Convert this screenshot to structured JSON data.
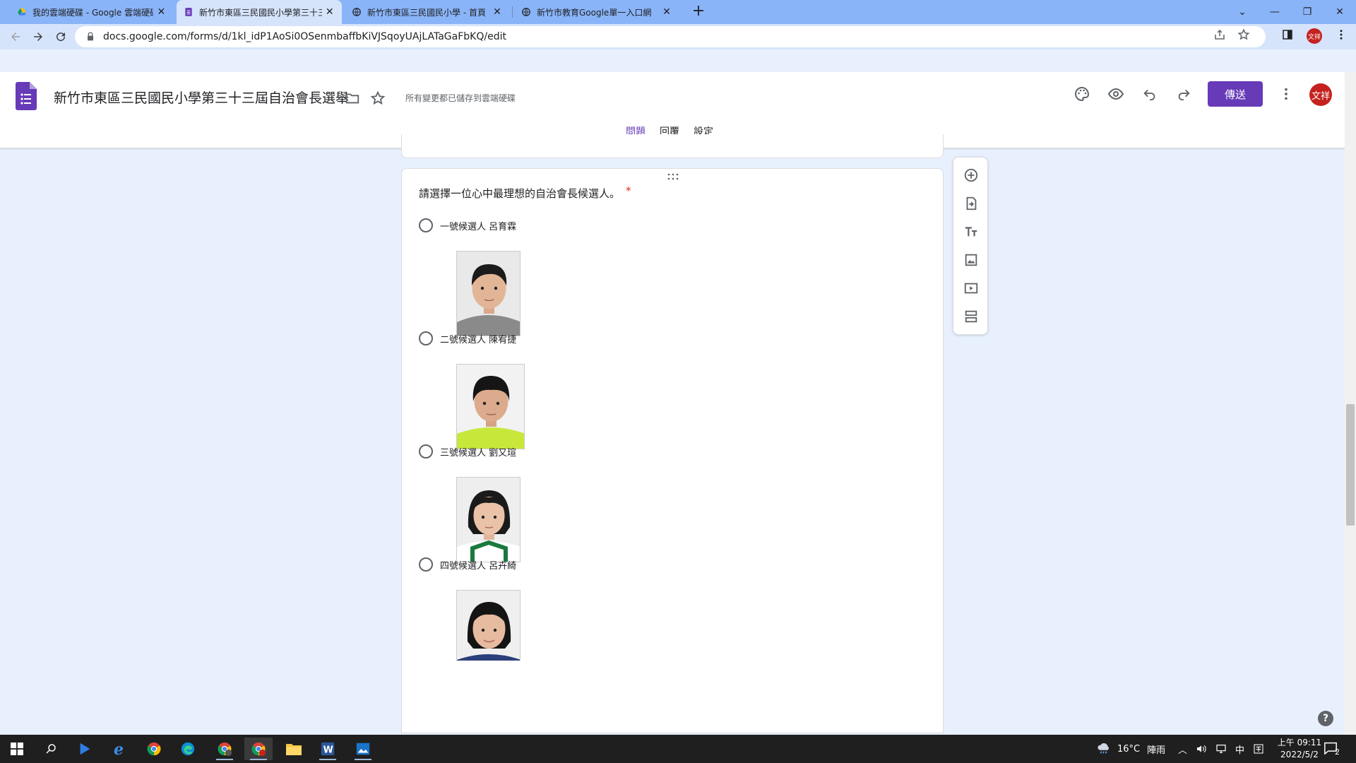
{
  "browser": {
    "tabs": [
      {
        "title": "我的雲端硬碟 - Google 雲端硬碟",
        "favicon": "google-drive-icon"
      },
      {
        "title": "新竹市東區三民國民小學第三十三屆",
        "favicon": "google-forms-icon",
        "active": true
      },
      {
        "title": "新竹市東區三民國民小學 - 首頁",
        "favicon": "globe-icon"
      },
      {
        "title": "新竹市教育Google單一入口網",
        "favicon": "globe-icon"
      }
    ],
    "url": "docs.google.com/forms/d/1kl_idP1AoSi0OSenmbaffbKiVJSqoyUAjLATaGaFbKQ/edit",
    "profile_initials": "文祥"
  },
  "forms_header": {
    "doc_title": "新竹市東區三民國民小學第三十三屆自治會長選舉",
    "save_status": "所有變更都已儲存到雲端硬碟",
    "send_label": "傳送",
    "avatar_initials": "文祥",
    "tabs": [
      {
        "label": "問題",
        "active": true
      },
      {
        "label": "回覆"
      },
      {
        "label": "設定"
      }
    ]
  },
  "question": {
    "title": "請選擇一位心中最理想的自治會長候選人。",
    "required_mark": "*",
    "options": [
      {
        "label": "一號候選人 呂育霖",
        "shirt_color": "#8a8a8a"
      },
      {
        "label": "二號候選人 陳宥捷",
        "shirt_color": "#c7e83a"
      },
      {
        "label": "三號候選人 劉又瑄",
        "shirt_color": "#1a7a3e"
      },
      {
        "label": "四號候選人 呂卉綺",
        "shirt_color": "#2b3f7a"
      }
    ]
  },
  "floating_toolbar": [
    "add-question-icon",
    "import-questions-icon",
    "add-title-icon",
    "add-image-icon",
    "add-video-icon",
    "add-section-icon"
  ],
  "taskbar": {
    "weather_temp": "16°C",
    "weather_desc": "陣雨",
    "ime": "中",
    "time": "上午 09:11",
    "date": "2022/5/2",
    "notification_count": "2"
  },
  "colors": {
    "forms_purple": "#673ab7",
    "tab_strip": "#8ab4f8",
    "page_bg": "#e8f0fe"
  }
}
